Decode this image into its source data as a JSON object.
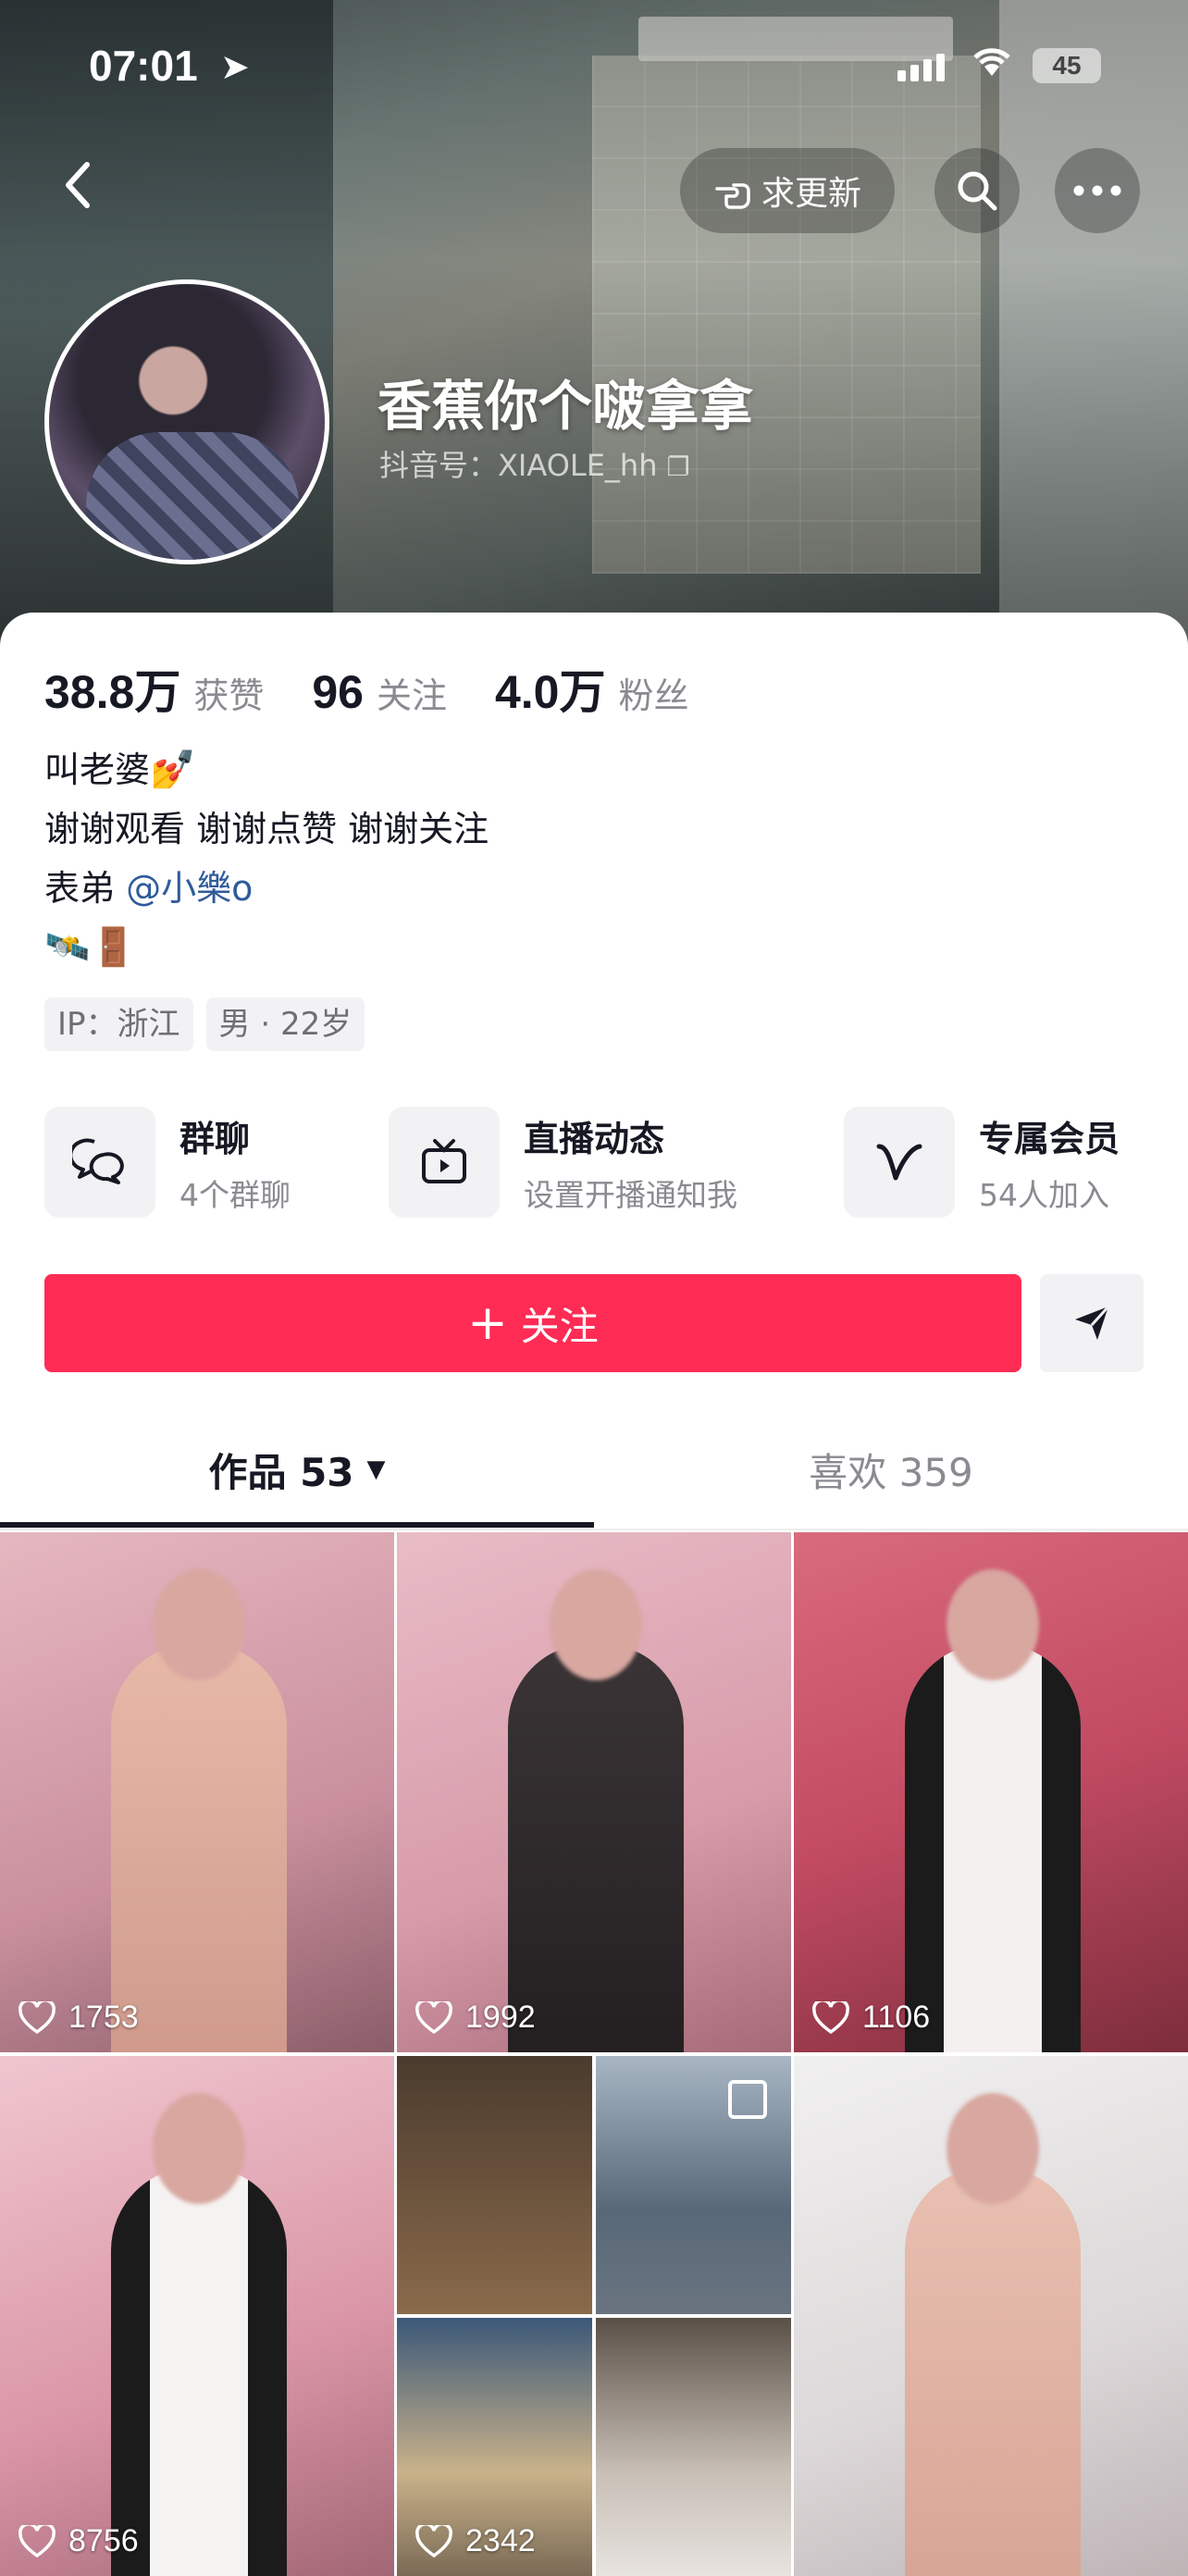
{
  "status_bar": {
    "time": "07:01",
    "battery": "45"
  },
  "header": {
    "update_label": "求更新"
  },
  "profile": {
    "name": "香蕉你个啵拿拿",
    "douyin_id": "抖音号：XIAOLE_hh",
    "stats": [
      {
        "value": "38.8万",
        "label": "获赞"
      },
      {
        "value": "96",
        "label": "关注"
      },
      {
        "value": "4.0万",
        "label": "粉丝"
      }
    ],
    "bio": {
      "line1": "叫老婆",
      "line1_emoji": "💅",
      "line2": "谢谢观看 谢谢点赞 谢谢关注",
      "line3_prefix": "表弟 ",
      "line3_mention": "@小樂o",
      "line4_emoji": "🛰️🚪"
    },
    "tags": [
      "IP：浙江",
      "男 · 22岁"
    ]
  },
  "features": [
    {
      "title": "群聊",
      "subtitle": "4个群聊",
      "icon": "group-chat-icon"
    },
    {
      "title": "直播动态",
      "subtitle": "设置开播通知我",
      "icon": "live-tv-icon"
    },
    {
      "title": "专属会员",
      "subtitle": "54人加入",
      "icon": "vip-v-icon"
    }
  ],
  "actions": {
    "follow_label": "关注"
  },
  "tabs": [
    {
      "label": "作品 53",
      "active": true
    },
    {
      "label": "喜欢 359",
      "active": false
    }
  ],
  "videos": [
    {
      "likes": "1753"
    },
    {
      "likes": "1992"
    },
    {
      "likes": "1106"
    },
    {
      "likes": "8756"
    },
    {
      "likes": "2342"
    },
    {
      "likes": ""
    }
  ],
  "colors": {
    "accent": "#fe2c55",
    "mention": "#2f5b9b",
    "text": "#161823",
    "muted": "#8a8b91"
  }
}
